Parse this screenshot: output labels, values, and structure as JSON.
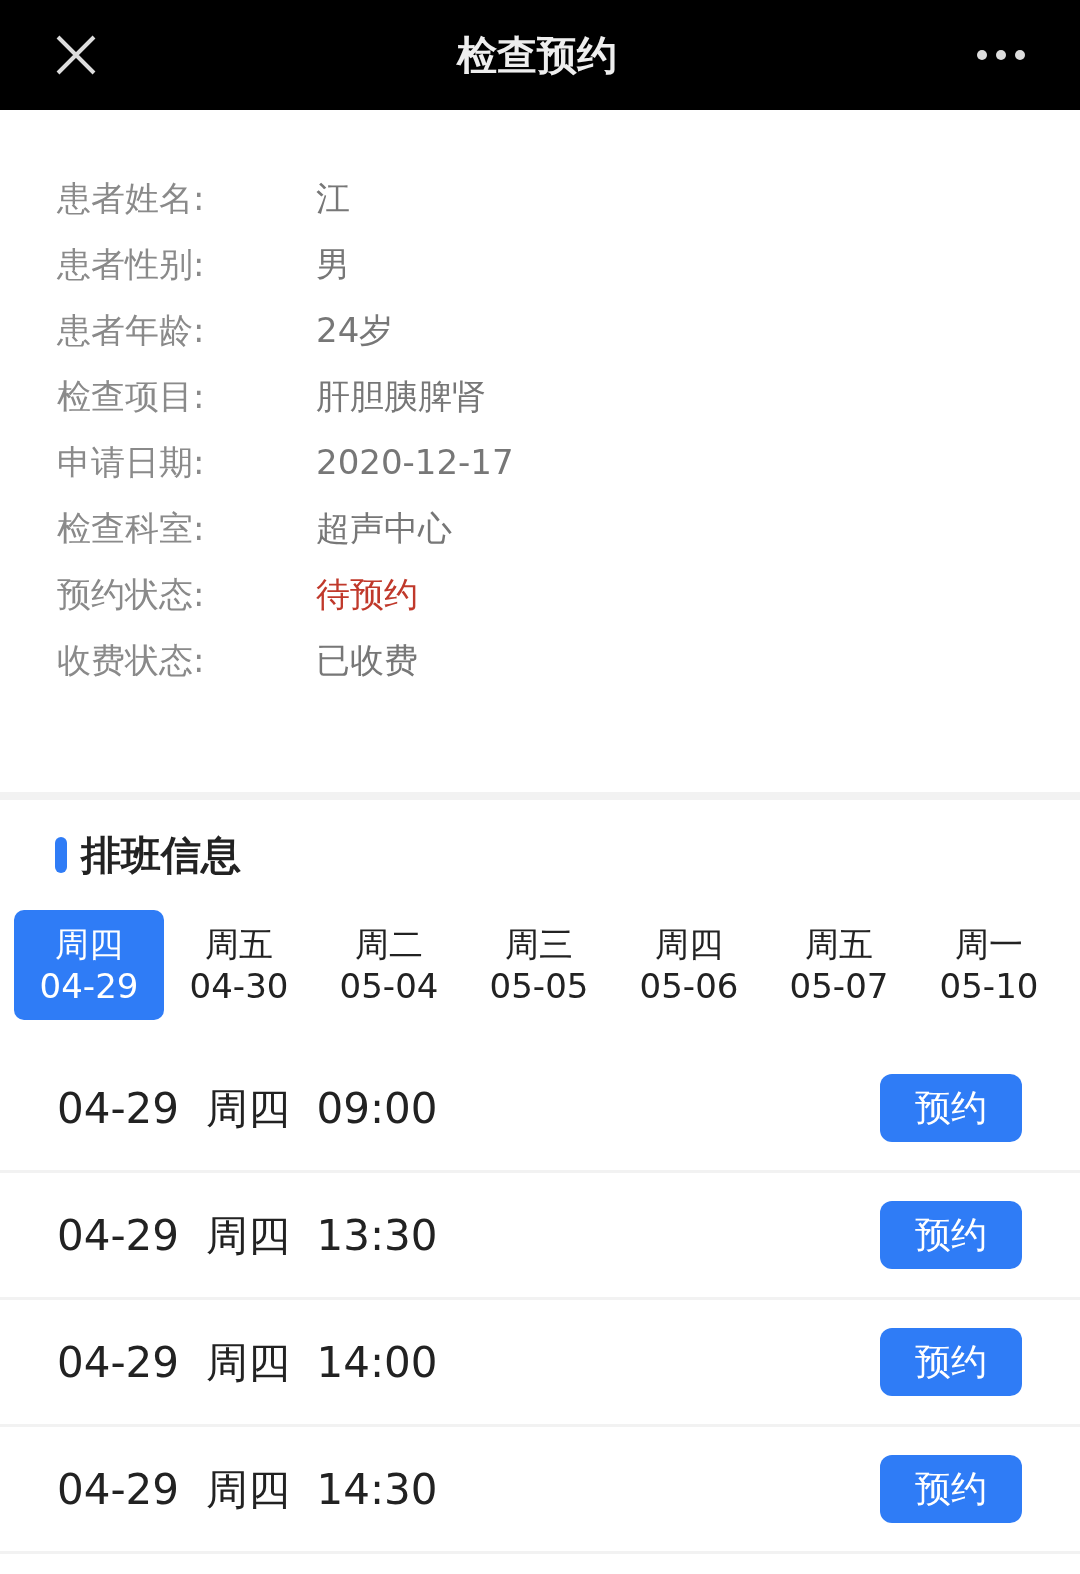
{
  "header": {
    "title": "检查预约"
  },
  "patient_info": [
    {
      "label": "患者姓名:",
      "value": "江",
      "kind": "normal"
    },
    {
      "label": "患者性别:",
      "value": "男",
      "kind": "normal"
    },
    {
      "label": "患者年龄:",
      "value": "24岁",
      "kind": "normal"
    },
    {
      "label": "检查项目:",
      "value": "肝胆胰脾肾",
      "kind": "normal"
    },
    {
      "label": "申请日期:",
      "value": "2020-12-17",
      "kind": "normal"
    },
    {
      "label": "检查科室:",
      "value": "超声中心",
      "kind": "normal"
    },
    {
      "label": "预约状态:",
      "value": "待预约",
      "kind": "alert"
    },
    {
      "label": "收费状态:",
      "value": "已收费",
      "kind": "normal"
    }
  ],
  "schedule": {
    "title": "排班信息",
    "days": [
      {
        "weekday": "周四",
        "date": "04-29",
        "selected": true
      },
      {
        "weekday": "周五",
        "date": "04-30",
        "selected": false
      },
      {
        "weekday": "周二",
        "date": "05-04",
        "selected": false
      },
      {
        "weekday": "周三",
        "date": "05-05",
        "selected": false
      },
      {
        "weekday": "周四",
        "date": "05-06",
        "selected": false
      },
      {
        "weekday": "周五",
        "date": "05-07",
        "selected": false
      },
      {
        "weekday": "周一",
        "date": "05-10",
        "selected": false
      }
    ],
    "slots": [
      {
        "date": "04-29",
        "weekday": "周四",
        "time": "09:00",
        "button": "预约"
      },
      {
        "date": "04-29",
        "weekday": "周四",
        "time": "13:30",
        "button": "预约"
      },
      {
        "date": "04-29",
        "weekday": "周四",
        "time": "14:00",
        "button": "预约"
      },
      {
        "date": "04-29",
        "weekday": "周四",
        "time": "14:30",
        "button": "预约"
      }
    ]
  }
}
